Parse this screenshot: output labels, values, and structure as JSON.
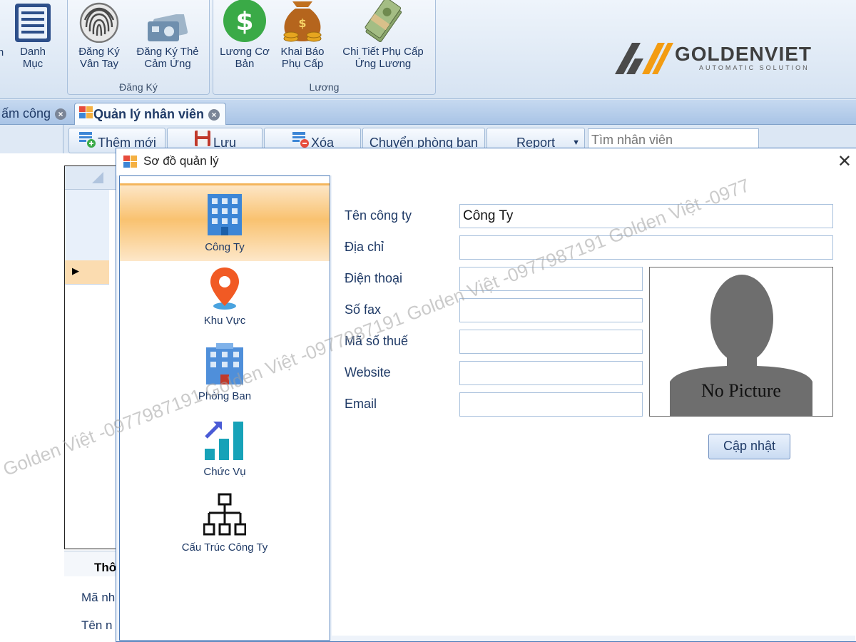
{
  "ribbon": {
    "partial_button": {
      "label_line2": "n"
    },
    "danh_muc": {
      "line1": "Danh",
      "line2": "Mục"
    },
    "dang_ky_group": {
      "label": "Đăng Ký",
      "buttons": [
        {
          "line1": "Đăng Ký",
          "line2": "Vân Tay",
          "icon": "fingerprint-icon"
        },
        {
          "line1": "Đăng Ký Thẻ",
          "line2": "Cảm Ứng",
          "icon": "card-reader-icon"
        }
      ]
    },
    "luong_group": {
      "label": "Lương",
      "buttons": [
        {
          "line1": "Lương Cơ",
          "line2": "Bản",
          "icon": "dollar-coin-icon"
        },
        {
          "line1": "Khai Báo",
          "line2": "Phụ Cấp",
          "icon": "money-bag-icon"
        },
        {
          "line1": "Chi Tiết Phụ Cấp",
          "line2": "Ứng Lương",
          "icon": "cash-bundle-icon"
        }
      ]
    },
    "logo": {
      "brand": "GOLDENVIET",
      "tagline": "AUTOMATIC SOLUTION"
    }
  },
  "tabs": [
    {
      "label": "ấm công"
    },
    {
      "label": "Quản lý nhân viên"
    }
  ],
  "toolbar": {
    "add": "Thêm mới",
    "save": "Lưu",
    "delete": "Xóa",
    "transfer": "Chuyển phòng ban",
    "report": "Report",
    "search_placeholder": "Tìm nhân viên"
  },
  "background_panel": {
    "tab_label": "Thô",
    "field1": "Mã nh",
    "field2": "Tên n"
  },
  "dialog": {
    "title": "Sơ đồ quản lý",
    "close": "✕",
    "nav": [
      {
        "label": "Công Ty",
        "icon": "office-building-icon",
        "active": true
      },
      {
        "label": "Khu Vực",
        "icon": "location-pin-icon",
        "active": false
      },
      {
        "label": "Phòng Ban",
        "icon": "department-building-icon",
        "active": false
      },
      {
        "label": "Chức Vụ",
        "icon": "growth-chart-icon",
        "active": false
      },
      {
        "label": "Cấu Trúc Công Ty",
        "icon": "org-chart-icon",
        "active": false
      }
    ],
    "form": {
      "company_name_label": "Tên công ty",
      "company_name_value": "Công Ty",
      "address_label": "Địa chỉ",
      "address_value": "",
      "phone_label": "Điện thoại",
      "phone_value": "",
      "fax_label": "Số fax",
      "fax_value": "",
      "tax_label": "Mã số thuế",
      "tax_value": "",
      "website_label": "Website",
      "website_value": "",
      "email_label": "Email",
      "email_value": "",
      "no_picture": "No Picture",
      "update_button": "Cập nhật"
    }
  },
  "watermark": "Golden Việt -0977987191 Golden Việt -0977987191 Golden Việt -0977987191 Golden Việt -0977",
  "colors": {
    "ribbon_text": "#1f3a66",
    "nav_active": "#f9c270",
    "coin_green": "#3aaa47",
    "pin_orange": "#f15a24",
    "building_blue": "#3d86d6",
    "logo_orange": "#f39c12"
  }
}
